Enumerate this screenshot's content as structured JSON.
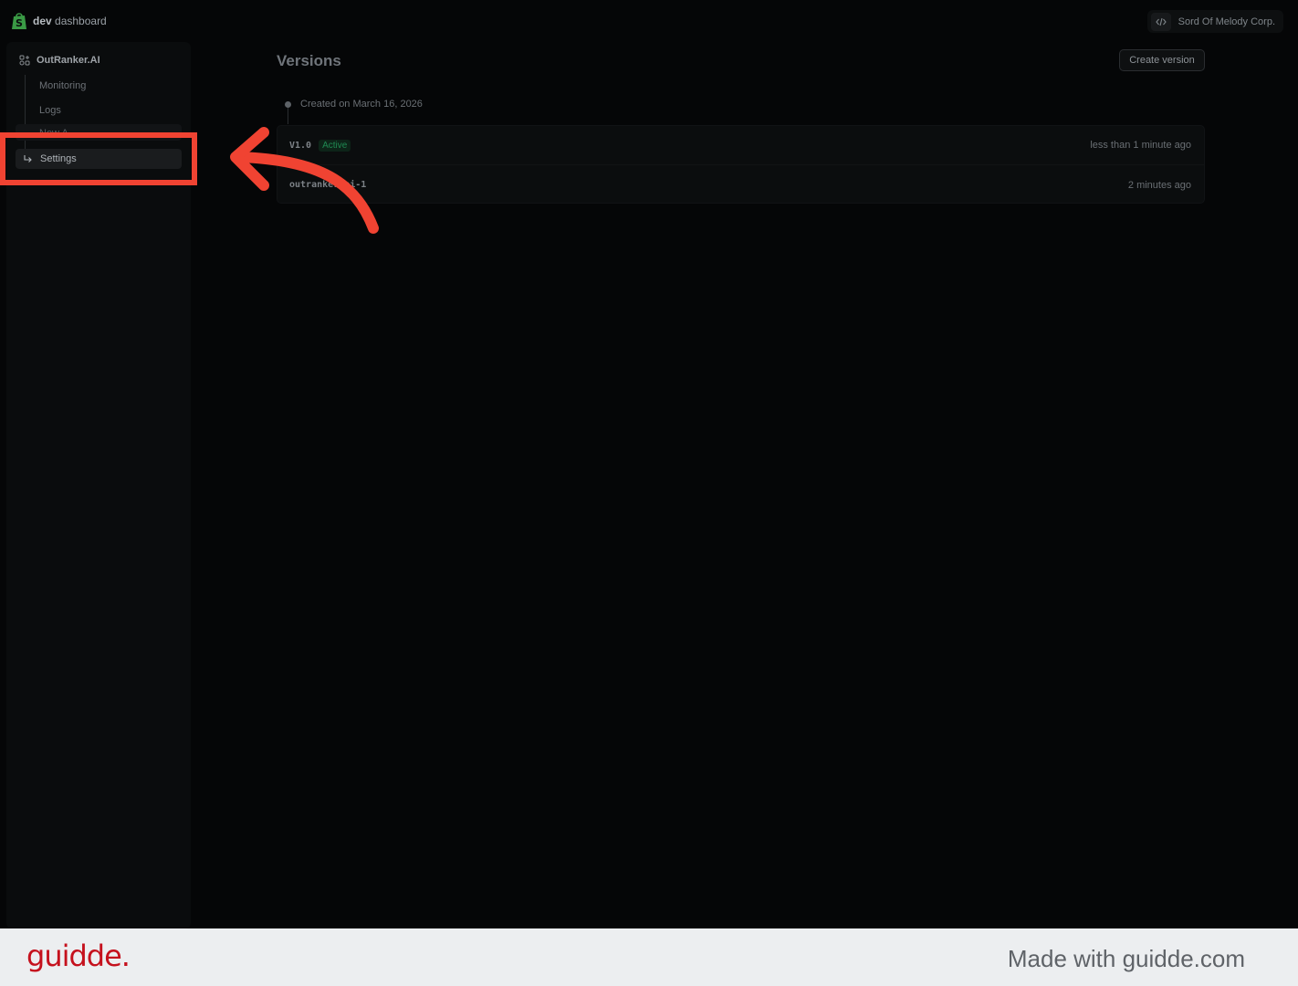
{
  "header": {
    "brand_bold": "dev",
    "brand_rest": " dashboard",
    "org_name": "Sord Of Melody Corp."
  },
  "sidebar": {
    "app_name": "OutRanker.AI",
    "items": [
      {
        "label": "Monitoring"
      },
      {
        "label": "Logs"
      },
      {
        "label": "New A"
      },
      {
        "label": "Settings"
      }
    ]
  },
  "main": {
    "title": "Versions",
    "create_button": "Create version",
    "created_label": "Created on March 16, 2026",
    "versions": [
      {
        "name": "V1.0",
        "badge": "Active",
        "time": "less than 1 minute ago"
      },
      {
        "name": "outranker-ai-1",
        "time": "2 minutes ago"
      }
    ]
  },
  "footer": {
    "logo": "guidde.",
    "credit": "Made with guidde.com"
  },
  "colors": {
    "background": "#050607",
    "highlight": "#f04332",
    "badge_green": "#1f8a52",
    "guidde_red": "#c5111d"
  },
  "icons": {
    "brand": "shopify-bag-icon",
    "code": "code-brackets-icon",
    "app": "apps-grid-icon",
    "settings": "corner-down-right-icon"
  }
}
